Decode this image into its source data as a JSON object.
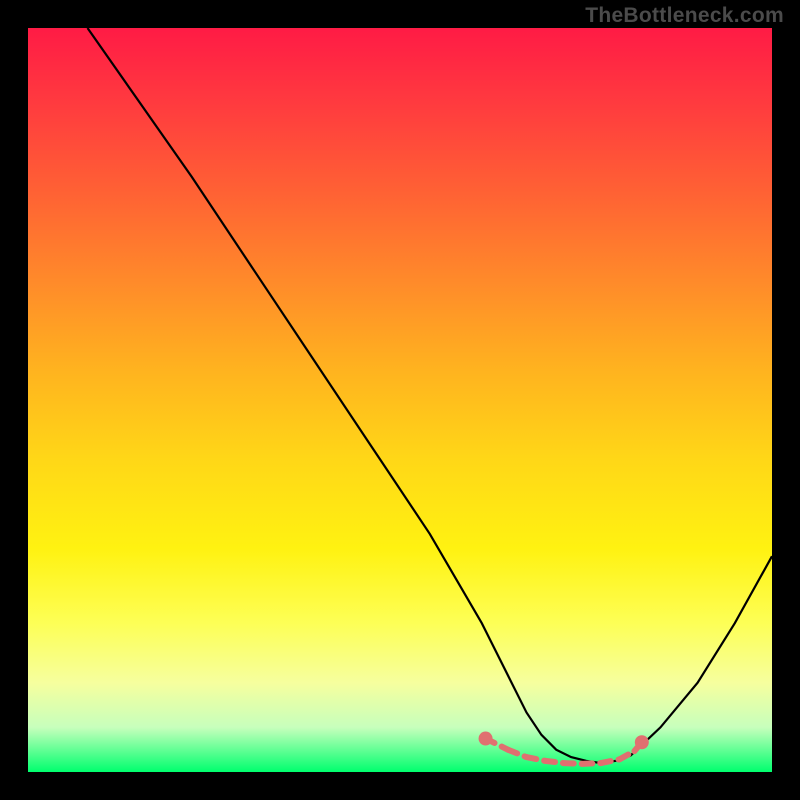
{
  "watermark": "TheBottleneck.com",
  "chart_data": {
    "type": "line",
    "title": "",
    "xlabel": "",
    "ylabel": "",
    "xlim": [
      0,
      100
    ],
    "ylim": [
      0,
      100
    ],
    "series": [
      {
        "name": "curve",
        "color": "#000000",
        "x": [
          8,
          15,
          22,
          30,
          38,
          46,
          54,
          61,
          65,
          67,
          69,
          71,
          73,
          75,
          77,
          79,
          81,
          85,
          90,
          95,
          100
        ],
        "values": [
          100,
          90,
          80,
          68,
          56,
          44,
          32,
          20,
          12,
          8,
          5,
          3,
          2,
          1.5,
          1.2,
          1.5,
          2.2,
          6,
          12,
          20,
          29
        ]
      }
    ],
    "markers": {
      "name": "optimal-range",
      "color": "#e07070",
      "x": [
        61.5,
        64.5,
        67,
        69.5,
        72,
        74.5,
        77,
        79.5,
        81.5,
        82.5
      ],
      "values": [
        4.5,
        3,
        2,
        1.5,
        1.2,
        1.1,
        1.2,
        1.7,
        2.8,
        4
      ]
    }
  }
}
